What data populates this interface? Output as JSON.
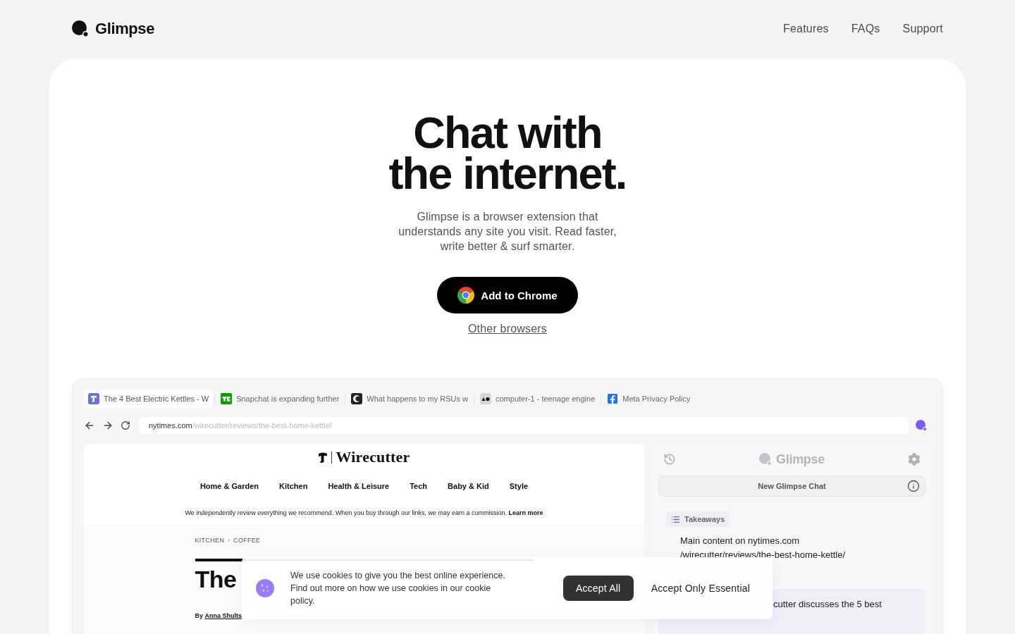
{
  "header": {
    "logo": "Glimpse",
    "nav": [
      {
        "label": "Features"
      },
      {
        "label": "FAQs"
      },
      {
        "label": "Support"
      }
    ]
  },
  "hero": {
    "title": "Chat with the internet.",
    "subtitle": "Glimpse is a browser extension that understands any site you visit. Read faster, write better & surf smarter.",
    "primary_button": "Add to Chrome",
    "secondary_link": "Other browsers"
  },
  "browser": {
    "tabs": [
      {
        "title": "The 4 Best Electric Kettles - W",
        "kind": "gothic",
        "selected": true
      },
      {
        "title": "Snapchat is expanding further",
        "kind": "green",
        "selected": false
      },
      {
        "title": "What happens to my RSUs w",
        "kind": "dark",
        "selected": false
      },
      {
        "title": "computer-1 - teenage engine",
        "kind": "grey",
        "selected": false
      },
      {
        "title": "Meta Privacy Policy",
        "kind": "facebook",
        "selected": false
      }
    ],
    "address": {
      "domain": "nytimes.com",
      "path": "/wirecutter/reviews/the-best-home-kettle/"
    },
    "page": {
      "logo": "Wirecutter",
      "nav": [
        {
          "label": "Home & Garden"
        },
        {
          "label": "Kitchen"
        },
        {
          "label": "Health & Leisure"
        },
        {
          "label": "Tech"
        },
        {
          "label": "Baby & Kid"
        },
        {
          "label": "Style"
        }
      ],
      "disclosure": {
        "text": "We independently review everything we recommend. When you buy through our links, we may earn a commission.",
        "link": "Learn more"
      },
      "breadcrumb": {
        "items": [
          "KITCHEN",
          "COFFEE"
        ],
        "separator": "›"
      },
      "headline": "The",
      "byline": [
        {
          "text": "By ",
          "link": false
        },
        {
          "text": "Anna Shults",
          "link": true
        }
      ]
    },
    "extension_panel": {
      "logo": "Glimpse",
      "new_chat_button": "New Glimpse Chat",
      "chip": "Takeaways",
      "summary": "Main content on nytimes.com /wirecutter/reviews/the-best-home-kettle/",
      "messages": [
        {
          "text": "cutter discusses the 5 best"
        }
      ]
    }
  },
  "cookie_banner": {
    "text": "We use cookies to give you the best online experience. Find out more on how we use cookies in our cookie policy.",
    "buttons": [
      {
        "label": "Accept All",
        "kind": "primary"
      },
      {
        "label": "Accept Only Essential",
        "kind": "plain"
      }
    ]
  }
}
